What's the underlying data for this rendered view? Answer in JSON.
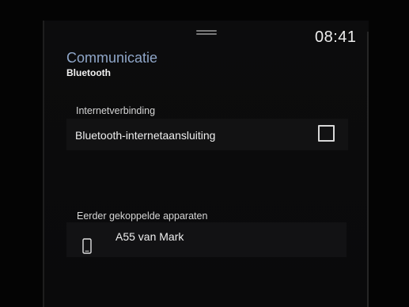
{
  "status_bar": {
    "clock": "08:41"
  },
  "header": {
    "title": "Communicatie",
    "subtitle": "Bluetooth"
  },
  "internet_section": {
    "label": "Internetverbinding",
    "option_label": "Bluetooth-internetaansluiting",
    "option_checked": false
  },
  "paired_section": {
    "label": "Eerder gekoppelde apparaten",
    "devices": [
      {
        "name": "A55 van Mark",
        "icon": "phone-icon"
      }
    ]
  },
  "colors": {
    "title": "#8fa6c8",
    "background": "#0a0a0b",
    "row": "#121213"
  }
}
